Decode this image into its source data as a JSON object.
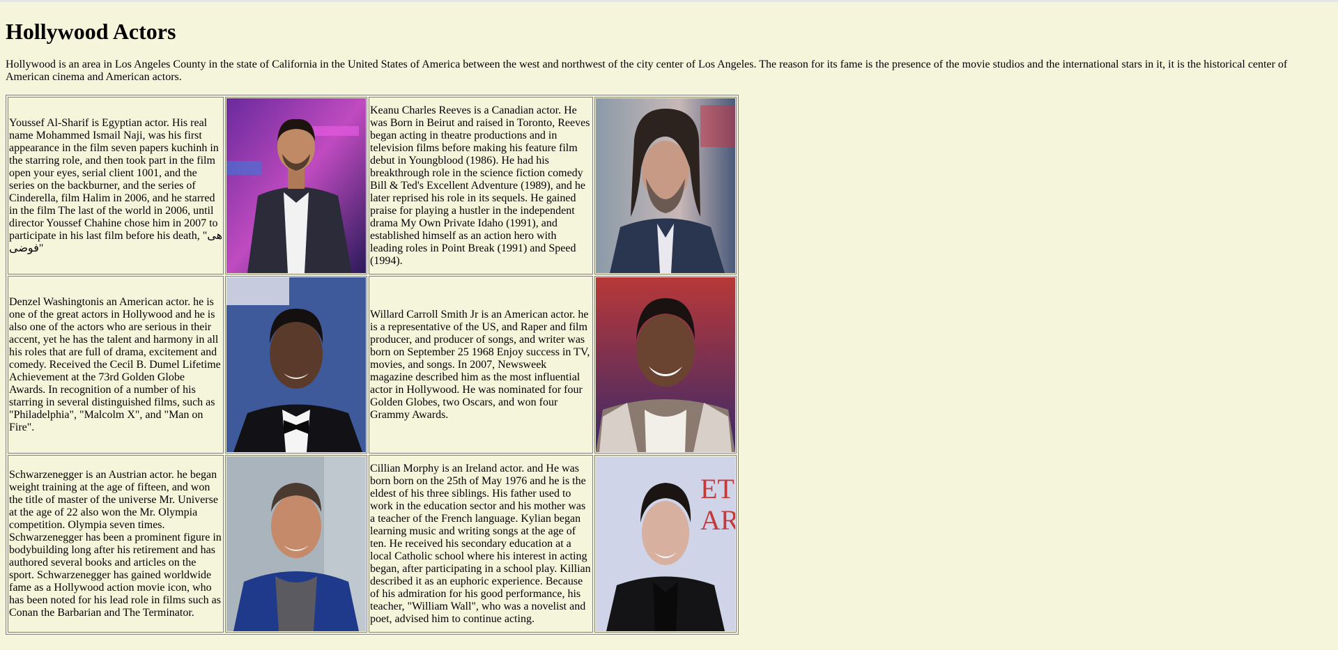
{
  "page": {
    "title": "Hollywood Actors",
    "intro": "Hollywood is an area in Los Angeles County in the state of California in the United States of America between the west and northwest of the city center of Los Angeles. The reason for its fame is the presence of the movie studios and the international stars in it, it is the historical center of American cinema and American actors."
  },
  "rows": [
    {
      "left_bio": "Youssef Al-Sharif is Egyptian actor. His real name Mohammed Ismail Naji, was his first appearance in the film seven papers kuchinh in the starring role, and then took part in the film open your eyes, serial client 1001, and the series on the backburner, and the series of Cinderella, film Halim in 2006, and he starred in the film The last of the world in 2006, until director Youssef Chahine chose him in 2007 to participate in his last film before his death, \"هى فوضى\"",
      "left_photo_icon": "portrait-youssef-al-sharif",
      "right_bio": "Keanu Charles Reeves is a Canadian actor. He was Born in Beirut and raised in Toronto, Reeves began acting in theatre productions and in television films before making his feature film debut in Youngblood (1986). He had his breakthrough role in the science fiction comedy Bill & Ted's Excellent Adventure (1989), and he later reprised his role in its sequels. He gained praise for playing a hustler in the independent drama My Own Private Idaho (1991), and established himself as an action hero with leading roles in Point Break (1991) and Speed (1994).",
      "right_photo_icon": "portrait-keanu-reeves"
    },
    {
      "left_bio": "Denzel Washingtonis an American actor. he is one of the great actors in Hollywood and he is also one of the actors who are serious in their accent, yet he has the talent and harmony in all his roles that are full of drama, excitement and comedy. Received the Cecil B. Dumel Lifetime Achievement at the 73rd Golden Globe Awards. In recognition of a number of his starring in several distinguished films, such as \"Philadelphia\", \"Malcolm X\", and \"Man on Fire\".",
      "left_photo_icon": "portrait-denzel-washington",
      "right_bio": "Willard Carroll Smith Jr is an American actor. he is a representative of the US, and Raper and film producer, and producer of songs, and writer was born on September 25 1968 Enjoy success in TV, movies, and songs. In 2007, Newsweek magazine described him as the most influential actor in Hollywood. He was nominated for four Golden Globes, two Oscars, and won four Grammy Awards.",
      "right_photo_icon": "portrait-will-smith"
    },
    {
      "left_bio": "Schwarzenegger is an Austrian actor. he began weight training at the age of fifteen, and won the title of master of the universe Mr. Universe at the age of 22 also won the Mr. Olympia competition. Olympia seven times. Schwarzenegger has been a prominent figure in bodybuilding long after his retirement and has authored several books and articles on the sport. Schwarzenegger has gained worldwide fame as a Hollywood action movie icon, who has been noted for his lead role in films such as Conan the Barbarian and The Terminator.",
      "left_photo_icon": "portrait-arnold-schwarzenegger",
      "right_bio": "Cillian Morphy is an Ireland actor. and He was born born on the 25th of May 1976 and he is the eldest of his three siblings. His father used to work in the education sector and his mother was a teacher of the French language. Kylian began learning music and writing songs at the age of ten. He received his secondary education at a local Catholic school where his interest in acting began, after participating in a school play. Killian described it as an euphoric experience. Because of his admiration for his good performance, his teacher, \"William Wall\", who was a novelist and poet, advised him to continue acting.",
      "right_photo_icon": "portrait-cillian-murphy",
      "right_photo_backdrop_text": "ET P\nART"
    }
  ],
  "colors": {
    "page_background": "#f5f5dc",
    "table_border": "#808080"
  }
}
